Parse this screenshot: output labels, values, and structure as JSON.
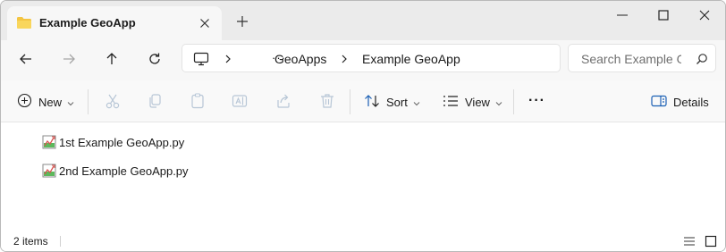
{
  "tab": {
    "title": "Example GeoApp",
    "close_icon": "close-icon",
    "new_tab_icon": "plus-icon"
  },
  "window_controls": [
    "minimize-icon",
    "maximize-icon",
    "close-icon"
  ],
  "nav": {
    "buttons": [
      "back-arrow-icon",
      "forward-arrow-icon",
      "up-arrow-icon",
      "refresh-icon"
    ],
    "address": {
      "root_icon": "computer-icon",
      "overflow": "···",
      "crumbs": [
        "GeoApps",
        "Example GeoApp"
      ]
    },
    "search": {
      "placeholder": "Search Example GeoApp",
      "visible_text": "Search Example G",
      "icon": "search-icon"
    }
  },
  "commandbar": {
    "new_label": "New",
    "sort_label": "Sort",
    "view_label": "View",
    "more_label": "···",
    "details_label": "Details",
    "disabled_icons": [
      "cut-icon",
      "copy-icon",
      "paste-icon",
      "rename-icon",
      "share-icon",
      "delete-icon"
    ]
  },
  "files": [
    {
      "name": "1st Example GeoApp.py",
      "icon": "python-file-icon"
    },
    {
      "name": "2nd Example GeoApp.py",
      "icon": "python-file-icon"
    }
  ],
  "status": {
    "item_count": "2 items",
    "view_icons": [
      "details-view-icon",
      "tiles-view-icon"
    ]
  },
  "colors": {
    "titlebar_bg": "#ebebeb",
    "tab_bg": "#f7f7f7",
    "folder_yellow": "#f4c542",
    "disabled_icon": "#b7c6d6",
    "accent": "#1a5fb4"
  }
}
